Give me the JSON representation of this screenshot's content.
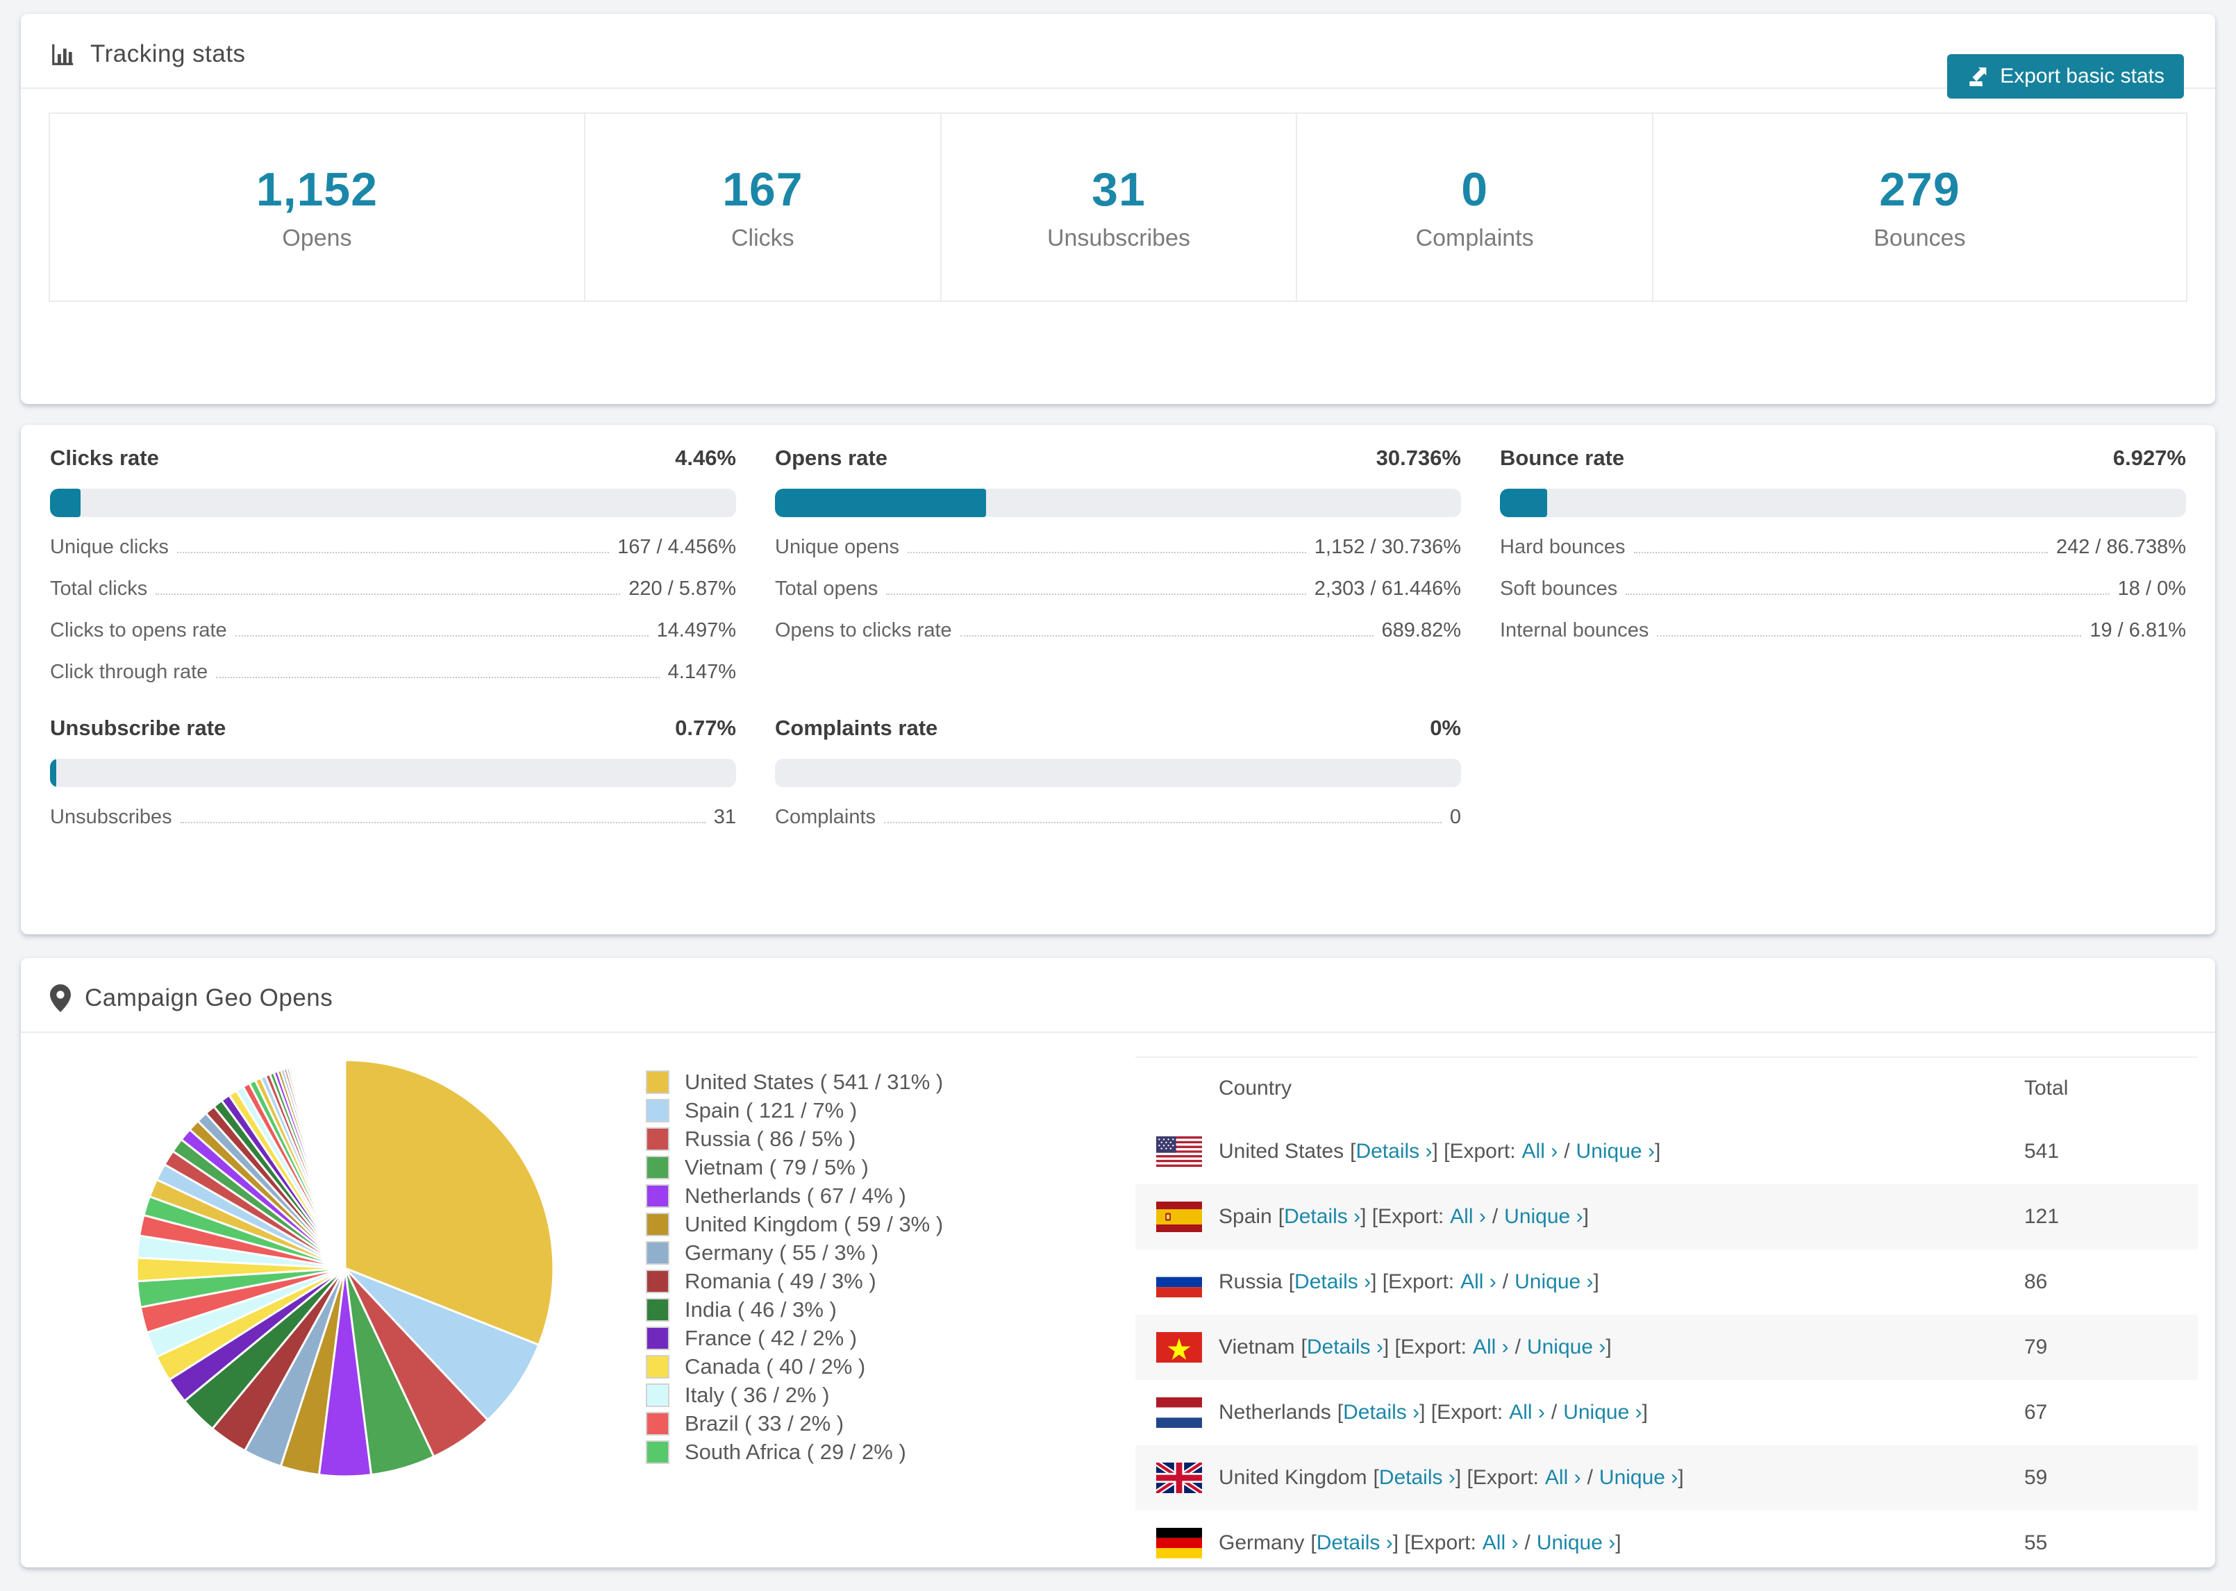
{
  "accent": "#15819c",
  "link_color": "#1b87a8",
  "bar_color": "#0e7f9e",
  "tracking": {
    "title": "Tracking stats",
    "export_button": "Export basic stats",
    "stats": [
      {
        "value": "1,152",
        "label": "Opens"
      },
      {
        "value": "167",
        "label": "Clicks"
      },
      {
        "value": "31",
        "label": "Unsubscribes"
      },
      {
        "value": "0",
        "label": "Complaints"
      },
      {
        "value": "279",
        "label": "Bounces"
      }
    ]
  },
  "rates": {
    "clicks": {
      "title": "Clicks rate",
      "value": "4.46%",
      "bar_pct": 4.46,
      "rows": [
        [
          "Unique clicks",
          "167 / 4.456%"
        ],
        [
          "Total clicks",
          "220 / 5.87%"
        ],
        [
          "Clicks to opens rate",
          "14.497%"
        ],
        [
          "Click through rate",
          "4.147%"
        ]
      ]
    },
    "opens": {
      "title": "Opens rate",
      "value": "30.736%",
      "bar_pct": 30.736,
      "rows": [
        [
          "Unique opens",
          "1,152 / 30.736%"
        ],
        [
          "Total opens",
          "2,303 / 61.446%"
        ],
        [
          "Opens to clicks rate",
          "689.82%"
        ]
      ]
    },
    "bounce": {
      "title": "Bounce rate",
      "value": "6.927%",
      "bar_pct": 6.927,
      "rows": [
        [
          "Hard bounces",
          "242 / 86.738%"
        ],
        [
          "Soft bounces",
          "18 / 0%"
        ],
        [
          "Internal bounces",
          "19 / 6.81%"
        ]
      ]
    },
    "unsubscribe": {
      "title": "Unsubscribe rate",
      "value": "0.77%",
      "bar_pct": 0.77,
      "rows": [
        [
          "Unsubscribes",
          "31"
        ]
      ]
    },
    "complaints": {
      "title": "Complaints rate",
      "value": "0%",
      "bar_pct": 0,
      "rows": [
        [
          "Complaints",
          "0"
        ]
      ]
    }
  },
  "geo": {
    "title": "Campaign Geo Opens",
    "legend": [
      {
        "label": "United States ( 541 / 31% )"
      },
      {
        "label": "Spain ( 121 / 7% )"
      },
      {
        "label": "Russia ( 86 / 5% )"
      },
      {
        "label": "Vietnam ( 79 / 5% )"
      },
      {
        "label": "Netherlands ( 67 / 4% )"
      },
      {
        "label": "United Kingdom ( 59 / 3% )"
      },
      {
        "label": "Germany ( 55 / 3% )"
      },
      {
        "label": "Romania ( 49 / 3% )"
      },
      {
        "label": "India ( 46 / 3% )"
      },
      {
        "label": "France ( 42 / 2% )"
      },
      {
        "label": "Canada ( 40 / 2% )"
      },
      {
        "label": "Italy ( 36 / 2% )"
      },
      {
        "label": "Brazil ( 33 / 2% )"
      },
      {
        "label": "South Africa ( 29 / 2% )"
      }
    ],
    "table": {
      "columns": [
        "Country",
        "Total"
      ],
      "links": {
        "details": "Details ›",
        "all": "All ›",
        "unique": "Unique ›"
      },
      "parts": {
        "p1": "[",
        "p2": "] [Export:",
        "p3": "/",
        "p4": "]"
      },
      "rows": [
        {
          "country": "United States",
          "total": "541",
          "flag": "us"
        },
        {
          "country": "Spain",
          "total": "121",
          "flag": "es"
        },
        {
          "country": "Russia",
          "total": "86",
          "flag": "ru"
        },
        {
          "country": "Vietnam",
          "total": "79",
          "flag": "vn"
        },
        {
          "country": "Netherlands",
          "total": "67",
          "flag": "nl"
        },
        {
          "country": "United Kingdom",
          "total": "59",
          "flag": "gb"
        },
        {
          "country": "Germany",
          "total": "55",
          "flag": "de"
        }
      ]
    }
  },
  "chart_data": {
    "type": "pie",
    "title": "Campaign Geo Opens",
    "unit": "opens",
    "start_angle_deg": -90,
    "direction": "clockwise",
    "legend_position": "right",
    "slices": [
      {
        "name": "United States",
        "value": 541,
        "pct": 31,
        "color": "#e7c245"
      },
      {
        "name": "Spain",
        "value": 121,
        "pct": 7,
        "color": "#aed5f1"
      },
      {
        "name": "Russia",
        "value": 86,
        "pct": 5,
        "color": "#c94f4f"
      },
      {
        "name": "Vietnam",
        "value": 79,
        "pct": 5,
        "color": "#4ca653"
      },
      {
        "name": "Netherlands",
        "value": 67,
        "pct": 4,
        "color": "#9b3df0"
      },
      {
        "name": "United Kingdom",
        "value": 59,
        "pct": 3,
        "color": "#bc9428"
      },
      {
        "name": "Germany",
        "value": 55,
        "pct": 3,
        "color": "#8fafcd"
      },
      {
        "name": "Romania",
        "value": 49,
        "pct": 3,
        "color": "#a83c3c"
      },
      {
        "name": "India",
        "value": 46,
        "pct": 3,
        "color": "#31803b"
      },
      {
        "name": "France",
        "value": 42,
        "pct": 2,
        "color": "#7129bd"
      },
      {
        "name": "Canada",
        "value": 40,
        "pct": 2,
        "color": "#f7df4d"
      },
      {
        "name": "Italy",
        "value": 36,
        "pct": 2,
        "color": "#d3f9fb"
      },
      {
        "name": "Brazil",
        "value": 33,
        "pct": 2,
        "color": "#ef5c5c"
      },
      {
        "name": "South Africa",
        "value": 29,
        "pct": 2,
        "color": "#57c96b"
      }
    ],
    "others": {
      "note": "many smaller countries, drawn clockwise after the named slices",
      "start_color_index": 10,
      "pct_values": [
        1.8,
        1.7,
        1.6,
        1.5,
        1.4,
        1.3,
        1.2,
        1.1,
        1.0,
        0.9,
        0.85,
        0.8,
        0.75,
        0.7,
        0.65,
        0.6,
        0.55,
        0.5,
        0.45,
        0.4,
        0.36,
        0.33,
        0.3,
        0.27,
        0.24,
        0.21,
        0.19,
        0.17,
        0.15,
        0.13,
        0.12,
        0.11,
        0.1,
        0.09,
        0.08,
        0.07,
        0.06,
        0.05,
        0.05,
        0.04,
        0.04,
        0.03,
        0.03,
        0.02,
        0.02,
        0.02,
        0.01,
        0.01
      ]
    },
    "colors": [
      "#e7c245",
      "#aed5f1",
      "#c94f4f",
      "#4ca653",
      "#9b3df0",
      "#bc9428",
      "#8fafcd",
      "#a83c3c",
      "#31803b",
      "#7129bd",
      "#f7df4d",
      "#d3f9fb",
      "#ef5c5c",
      "#57c96b"
    ]
  }
}
